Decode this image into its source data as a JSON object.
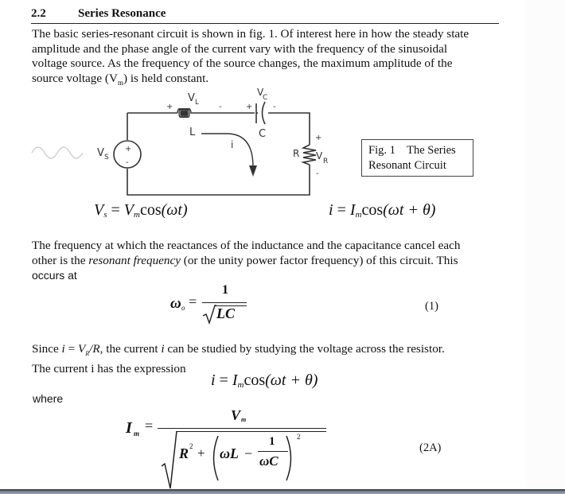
{
  "section": {
    "number": "2.2",
    "title": "Series Resonance"
  },
  "intro_paragraph": [
    "The basic series-resonant circuit is shown in fig. 1.  Of  interest here in how the steady state",
    "amplitude and the phase angle of the current vary with the frequency of the sinusoidal",
    "voltage source.  As the frequency of the source changes, the maximum amplitude of the",
    "source voltage (V",
    "m",
    ") is held constant."
  ],
  "figure": {
    "caption_line1": "Fig. 1    The Series",
    "caption_line2": "Resonant Circuit",
    "labels": {
      "source": "V",
      "source_sub": "S",
      "source_plus": "+",
      "source_minus": "-",
      "inductor_voltage": "V",
      "inductor_voltage_sub": "L",
      "inductor": "L",
      "capacitor_voltage": "V",
      "capacitor_voltage_sub": "C",
      "capacitor": "C",
      "resistor": "R",
      "resistor_voltage": "V",
      "resistor_voltage_sub": "R",
      "current": "i",
      "plus": "+",
      "minus": "-"
    }
  },
  "equations": {
    "source_eq": {
      "lhs": "V",
      "lhs_sub": "s",
      "eq": " = ",
      "amp": "V",
      "amp_sub": "m",
      "func": "cos",
      "arg": "(ωt)"
    },
    "current_eq": {
      "lhs": "i",
      "eq": " = ",
      "amp": "I",
      "amp_sub": "m",
      "func": "cos",
      "arg": "(ωt + θ)"
    },
    "resonant": {
      "lhs": "ω",
      "lhs_sub": "o",
      "eq": "=",
      "numerator": "1",
      "denominator": "LC",
      "number": "(1)"
    },
    "current_eq2": {
      "lhs": "i",
      "eq": " = ",
      "amp": "I",
      "amp_sub": "m",
      "func": "cos",
      "arg": "(ωt + θ)"
    },
    "amplitude": {
      "lhs": "I",
      "lhs_sub": "m",
      "eq": "=",
      "numerator": "V",
      "numerator_sub": "m",
      "r_term": "R",
      "r_exp": "2",
      "plus": "+",
      "omega_l": "ωL",
      "minus": "−",
      "inner_num": "1",
      "inner_den": "ωC",
      "outer_exp": "2",
      "number": "(2A)"
    }
  },
  "resonance_paragraph": {
    "line1": "The frequency at which the reactances of the inductance and the capacitance cancel each",
    "line2_pre": "other is the ",
    "line2_em": "resonant frequency",
    "line2_post": " (or the unity power factor frequency) of this circuit.  This",
    "line3": "occurs at"
  },
  "since_paragraph": {
    "pre": "Since ",
    "i1": "i",
    "eq": " = ",
    "vr": "V",
    "vr_sub": "R",
    "slash_r": "/R",
    "mid": ", the current ",
    "i2": "i",
    "post": " can be studied by studying the voltage across the resistor.",
    "line2": "The current i has the expression"
  },
  "where_label": "where",
  "colors": {
    "text": "#111111",
    "circuit": "#333333",
    "sine_wave": "#cfcfcf",
    "window_bar": "#6d7a8a"
  }
}
